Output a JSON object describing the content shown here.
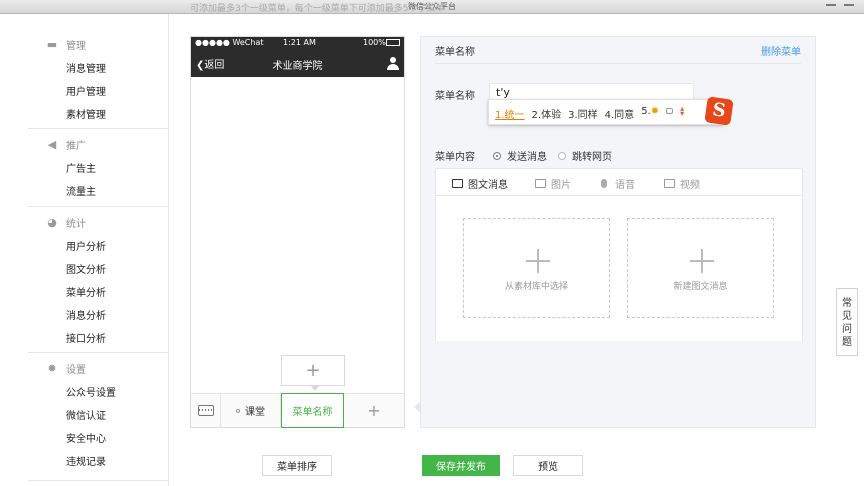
{
  "window": {
    "title": "微信公众平台"
  },
  "top_hint": "可添加最多3个一级菜单，每个一级菜单下可添加最多5个子菜单",
  "sidebar": {
    "groups": [
      {
        "title": "管理",
        "icon": "folder-icon",
        "items": [
          "消息管理",
          "用户管理",
          "素材管理"
        ]
      },
      {
        "title": "推广",
        "icon": "megaphone-icon",
        "items": [
          "广告主",
          "流量主"
        ]
      },
      {
        "title": "统计",
        "icon": "pie-chart-icon",
        "items": [
          "用户分析",
          "图文分析",
          "菜单分析",
          "消息分析",
          "接口分析"
        ]
      },
      {
        "title": "设置",
        "icon": "gear-icon",
        "items": [
          "公众号设置",
          "微信认证",
          "安全中心",
          "违规记录"
        ]
      }
    ]
  },
  "phone": {
    "status": {
      "carrier": "●●●●● WeChat",
      "time": "1:21 AM",
      "battery": "100%"
    },
    "back_label": "返回",
    "title": "术业商学院",
    "submenu_add": "+",
    "menus": [
      "课堂",
      "菜单名称"
    ],
    "menu_add": "+"
  },
  "editor": {
    "header_title": "菜单名称",
    "delete_label": "删除菜单",
    "name_label": "菜单名称",
    "name_value": "t'y",
    "content_label": "菜单内容",
    "radio_send": "发送消息",
    "radio_jump": "跳转网页",
    "tabs": [
      "图文消息",
      "图片",
      "语音",
      "视频"
    ],
    "card_choose": "从素材库中选择",
    "card_new": "新建图文消息"
  },
  "ime": {
    "candidates": [
      "1.统一",
      "2.体验",
      "3.同样",
      "4.同意",
      "5."
    ],
    "logo": "S"
  },
  "buttons": {
    "sort": "菜单排序",
    "save": "保存并发布",
    "preview": "预览"
  },
  "faq": [
    "常",
    "见",
    "问",
    "题"
  ]
}
